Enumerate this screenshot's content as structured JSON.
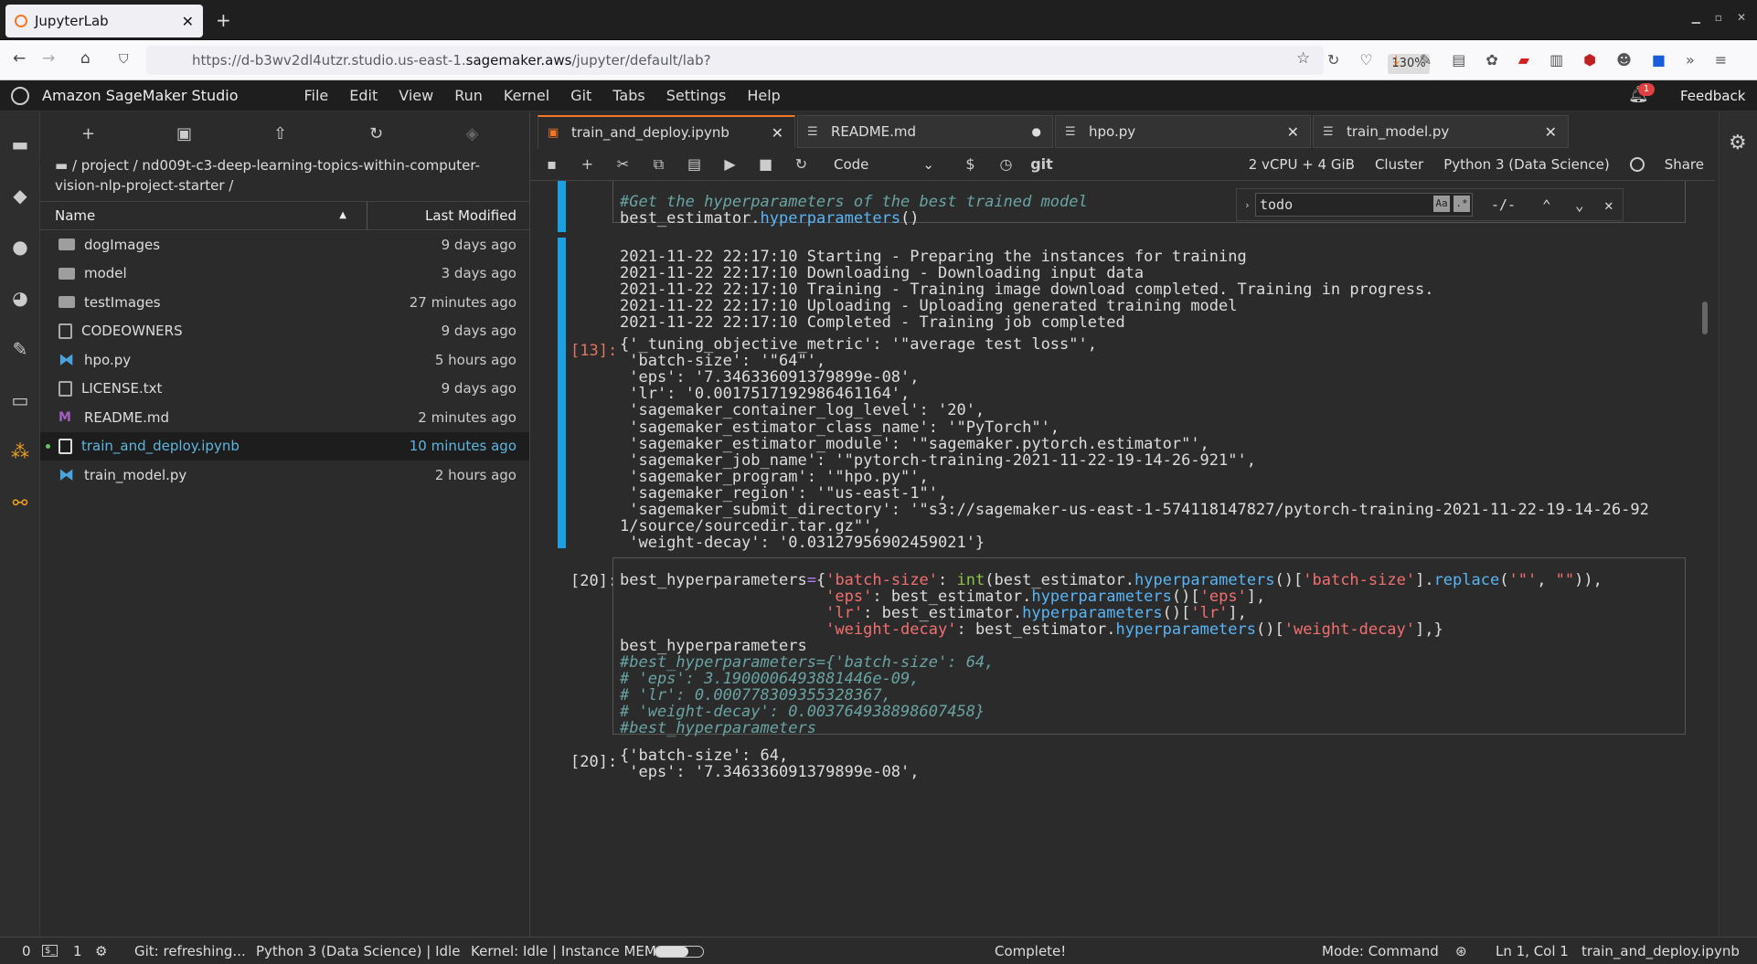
{
  "browser": {
    "tab_title": "JupyterLab",
    "url_prefix": "https://d-b3wv2dl4utzr.studio.us-east-1.",
    "url_domain": "sagemaker.aws",
    "url_suffix": "/jupyter/default/lab?",
    "zoom": "130%"
  },
  "app": {
    "title": "Amazon SageMaker Studio",
    "menus": [
      "File",
      "Edit",
      "View",
      "Run",
      "Kernel",
      "Git",
      "Tabs",
      "Settings",
      "Help"
    ],
    "notification_count": "1",
    "feedback": "Feedback"
  },
  "file_browser": {
    "breadcrumb": "/ project / nd009t-c3-deep-learning-topics-within-computer-vision-nlp-project-starter /",
    "col_name": "Name",
    "col_modified": "Last Modified",
    "items": [
      {
        "name": "dogImages",
        "modified": "9 days ago",
        "icon": "folder-icon"
      },
      {
        "name": "model",
        "modified": "3 days ago",
        "icon": "folder-icon"
      },
      {
        "name": "testImages",
        "modified": "27 minutes ago",
        "icon": "folder-icon"
      },
      {
        "name": "CODEOWNERS",
        "modified": "9 days ago",
        "icon": "file-icon"
      },
      {
        "name": "hpo.py",
        "modified": "5 hours ago",
        "icon": "python-icon"
      },
      {
        "name": "LICENSE.txt",
        "modified": "9 days ago",
        "icon": "file-icon"
      },
      {
        "name": "README.md",
        "modified": "2 minutes ago",
        "icon": "markdown-icon"
      },
      {
        "name": "train_and_deploy.ipynb",
        "modified": "10 minutes ago",
        "icon": "notebook-icon"
      },
      {
        "name": "train_model.py",
        "modified": "2 hours ago",
        "icon": "python-icon"
      }
    ]
  },
  "doc_tabs": [
    {
      "label": "train_and_deploy.ipynb"
    },
    {
      "label": "README.md"
    },
    {
      "label": "hpo.py"
    },
    {
      "label": "train_model.py"
    }
  ],
  "notebook_toolbar": {
    "cell_type": "Code",
    "git": "git",
    "instance": "2 vCPU + 4 GiB",
    "cluster": "Cluster",
    "kernel": "Python 3 (Data Science)",
    "share": "Share"
  },
  "find": {
    "query": "todo",
    "count": "-/-"
  },
  "cells": {
    "cell_a": {
      "comment": "#Get the hyperparameters of the best trained model",
      "code_obj": "best_estimator.",
      "code_fn": "hyperparameters",
      "code_end": "()"
    },
    "log_lines": [
      "2021-11-22 22:17:10 Starting - Preparing the instances for training",
      "2021-11-22 22:17:10 Downloading - Downloading input data",
      "2021-11-22 22:17:10 Training - Training image download completed. Training in progress.",
      "2021-11-22 22:17:10 Uploading - Uploading generated training model",
      "2021-11-22 22:17:10 Completed - Training job completed"
    ],
    "out13_prompt": "[13]:",
    "out13_lines": [
      "{'_tuning_objective_metric': '\"average test loss\"',",
      " 'batch-size': '\"64\"',",
      " 'eps': '7.346336091379899e-08',",
      " 'lr': '0.0017517192986461164',",
      " 'sagemaker_container_log_level': '20',",
      " 'sagemaker_estimator_class_name': '\"PyTorch\"',",
      " 'sagemaker_estimator_module': '\"sagemaker.pytorch.estimator\"',",
      " 'sagemaker_job_name': '\"pytorch-training-2021-11-22-19-14-26-921\"',",
      " 'sagemaker_program': '\"hpo.py\"',",
      " 'sagemaker_region': '\"us-east-1\"',",
      " 'sagemaker_submit_directory': '\"s3://sagemaker-us-east-1-574118147827/pytorch-training-2021-11-22-19-14-26-92",
      "1/source/sourcedir.tar.gz\"',",
      " 'weight-decay': '0.03127956902459021'}"
    ],
    "in20_prompt": "[20]:",
    "in20_comments": [
      "#best_hyperparameters={'batch-size': 64,",
      "# 'eps': 3.1900006493881446e-09,",
      "# 'lr': 0.000778309355328367,",
      "# 'weight-decay': 0.003764938898607458}",
      "#best_hyperparameters"
    ],
    "in20_last": "best_hyperparameters",
    "out20_prompt": "[20]:",
    "out20_lines": [
      "{'batch-size': 64,",
      " 'eps': '7.346336091379899e-08',"
    ]
  },
  "status_bar": {
    "terminals": "0",
    "kernels": "1",
    "git": "Git: refreshing...",
    "kernel_state": "Python 3 (Data Science) | Idle",
    "kernel_mem": "Kernel: Idle | Instance MEM",
    "complete": "Complete!",
    "mode": "Mode: Command",
    "position": "Ln 1, Col 1",
    "file": "train_and_deploy.ipynb"
  }
}
